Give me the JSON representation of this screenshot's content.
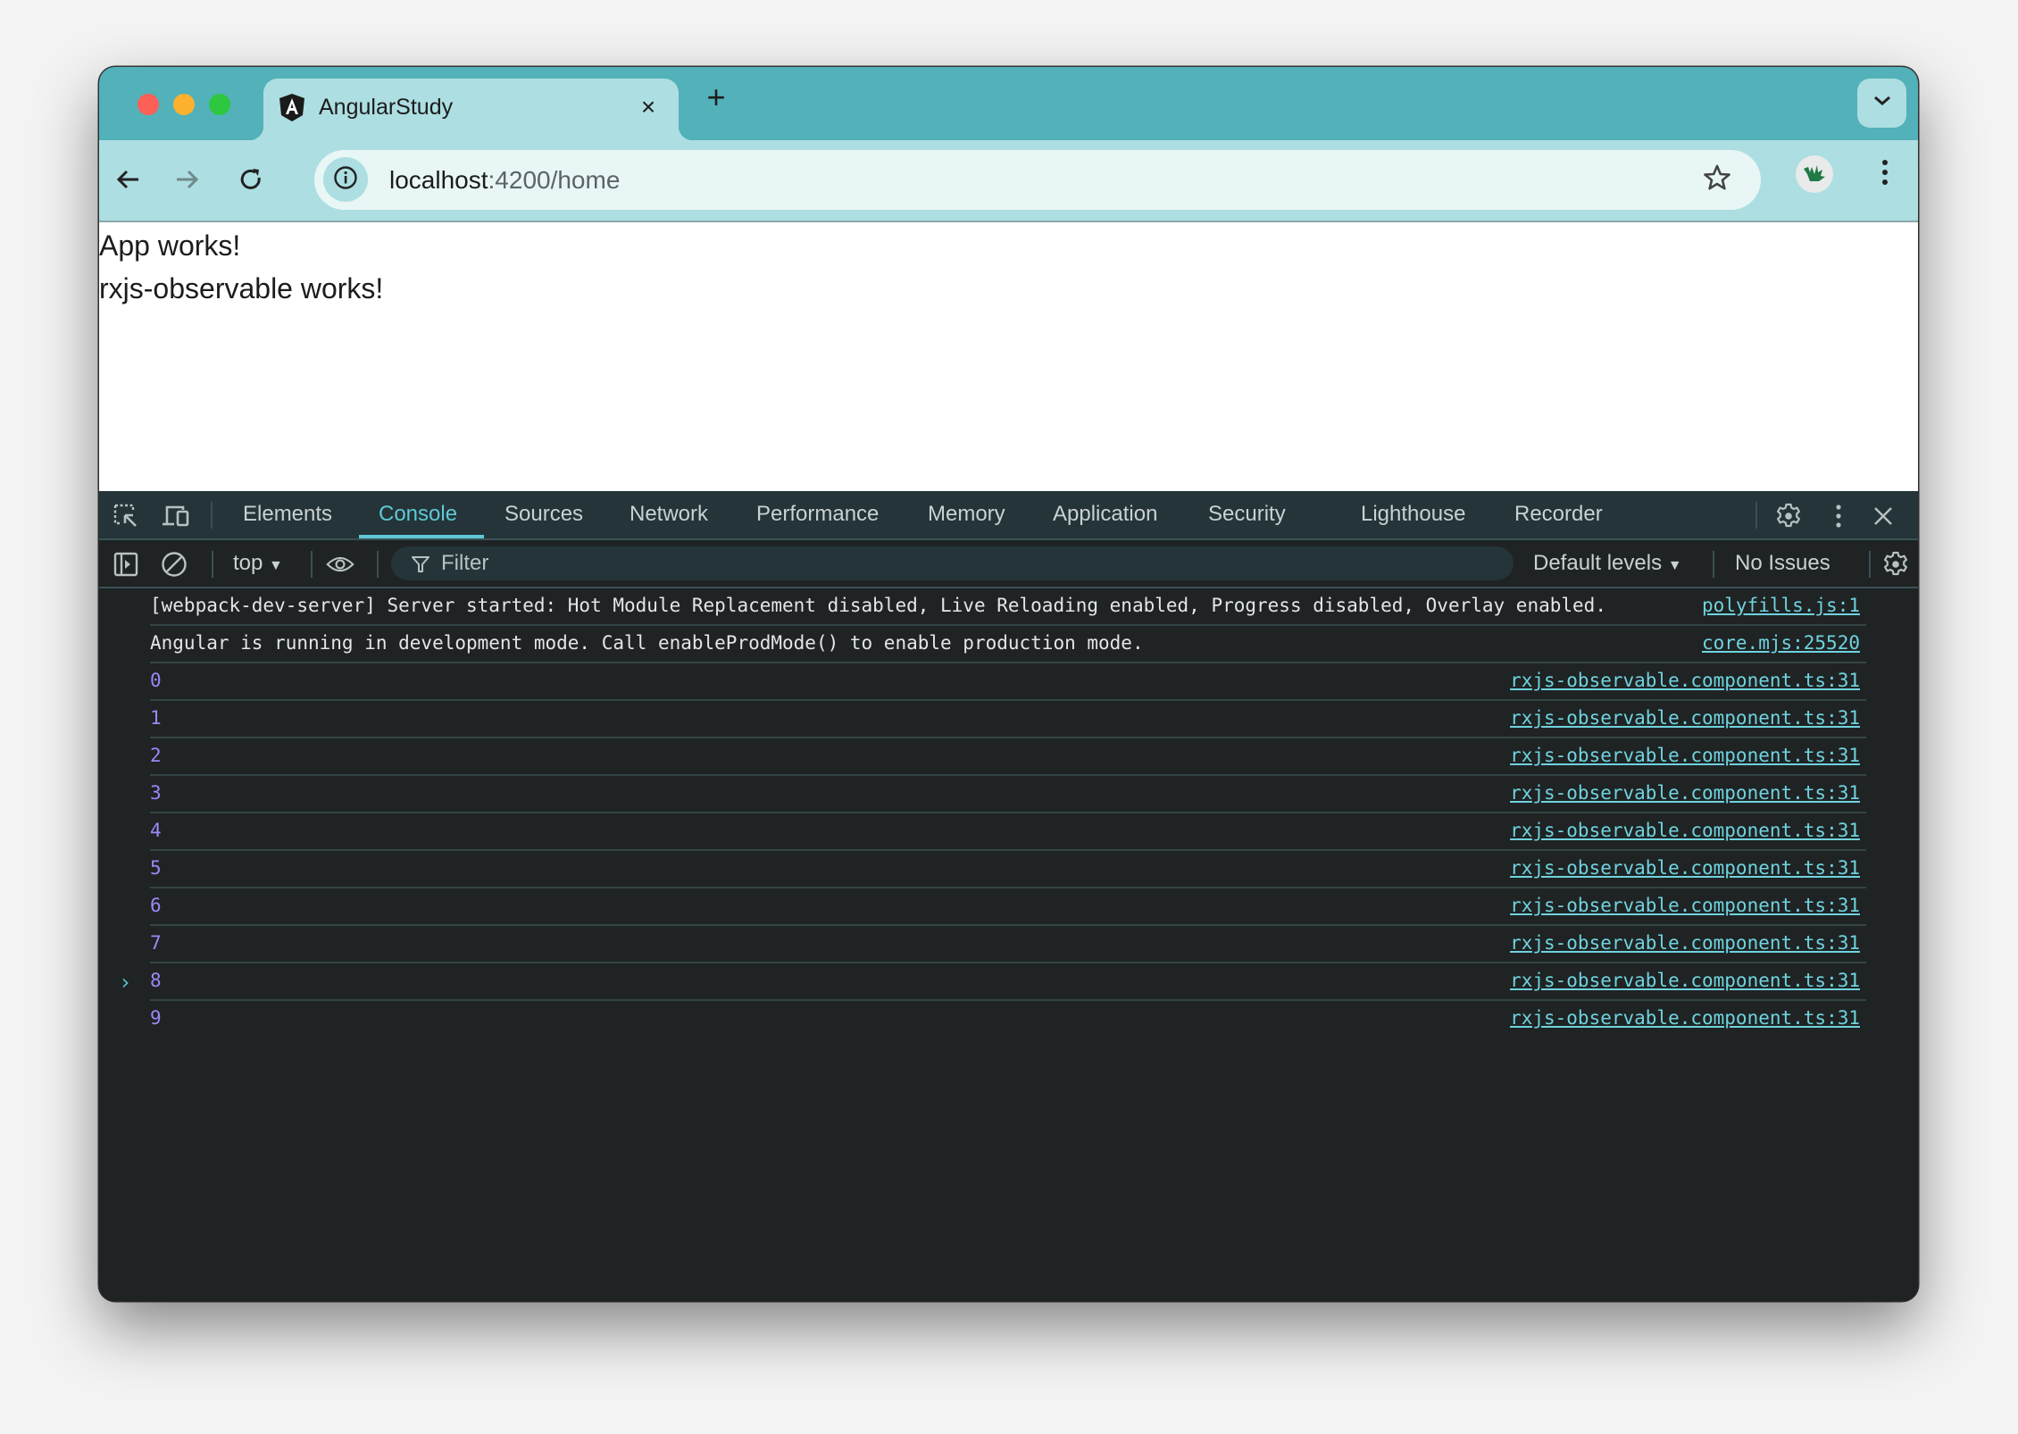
{
  "browser": {
    "tab": {
      "title": "AngularStudy",
      "favicon": "angular-logo-icon",
      "close_icon": "×"
    },
    "new_tab_icon": "+",
    "address_bar": {
      "host": "localhost",
      "rest": ":4200/home"
    },
    "icons": {
      "back": "arrow-left-icon",
      "forward": "arrow-right-icon",
      "reload": "reload-icon",
      "site_info": "info-icon",
      "bookmark": "star-icon",
      "profile": "avatar",
      "menu": "kebab-menu-icon",
      "tab_search": "chevron-down-icon"
    }
  },
  "page": {
    "lines": [
      "App works!",
      "rxjs-observable works!"
    ]
  },
  "devtools": {
    "tabs": [
      {
        "label": "Elements",
        "active": false
      },
      {
        "label": "Console",
        "active": true
      },
      {
        "label": "Sources",
        "active": false
      },
      {
        "label": "Network",
        "active": false
      },
      {
        "label": "Performance",
        "active": false
      },
      {
        "label": "Memory",
        "active": false
      },
      {
        "label": "Application",
        "active": false
      },
      {
        "label": "Security",
        "active": false
      },
      {
        "label": "Lighthouse",
        "active": false
      },
      {
        "label": "Recorder",
        "active": false
      }
    ],
    "console_toolbar": {
      "context": "top",
      "filter_placeholder": "Filter",
      "levels": "Default levels",
      "issues": "No Issues"
    },
    "colors": {
      "accent": "#5fc9d5",
      "number": "#9a88f5",
      "link": "#6fd3de"
    },
    "log": [
      {
        "message": "[webpack-dev-server] Server started: Hot Module Replacement disabled, Live Reloading enabled, Progress disabled, Overlay enabled.",
        "source": "polyfills.js:1",
        "type": "text"
      },
      {
        "message": "Angular is running in development mode. Call enableProdMode() to enable production mode.",
        "source": "core.mjs:25520",
        "type": "text"
      },
      {
        "message": "0",
        "source": "rxjs-observable.component.ts:31",
        "type": "number"
      },
      {
        "message": "1",
        "source": "rxjs-observable.component.ts:31",
        "type": "number"
      },
      {
        "message": "2",
        "source": "rxjs-observable.component.ts:31",
        "type": "number"
      },
      {
        "message": "3",
        "source": "rxjs-observable.component.ts:31",
        "type": "number"
      },
      {
        "message": "4",
        "source": "rxjs-observable.component.ts:31",
        "type": "number"
      },
      {
        "message": "5",
        "source": "rxjs-observable.component.ts:31",
        "type": "number"
      },
      {
        "message": "6",
        "source": "rxjs-observable.component.ts:31",
        "type": "number"
      },
      {
        "message": "7",
        "source": "rxjs-observable.component.ts:31",
        "type": "number"
      },
      {
        "message": "8",
        "source": "rxjs-observable.component.ts:31",
        "type": "number"
      },
      {
        "message": "9",
        "source": "rxjs-observable.component.ts:31",
        "type": "number"
      }
    ],
    "prompt_symbol": "›"
  }
}
